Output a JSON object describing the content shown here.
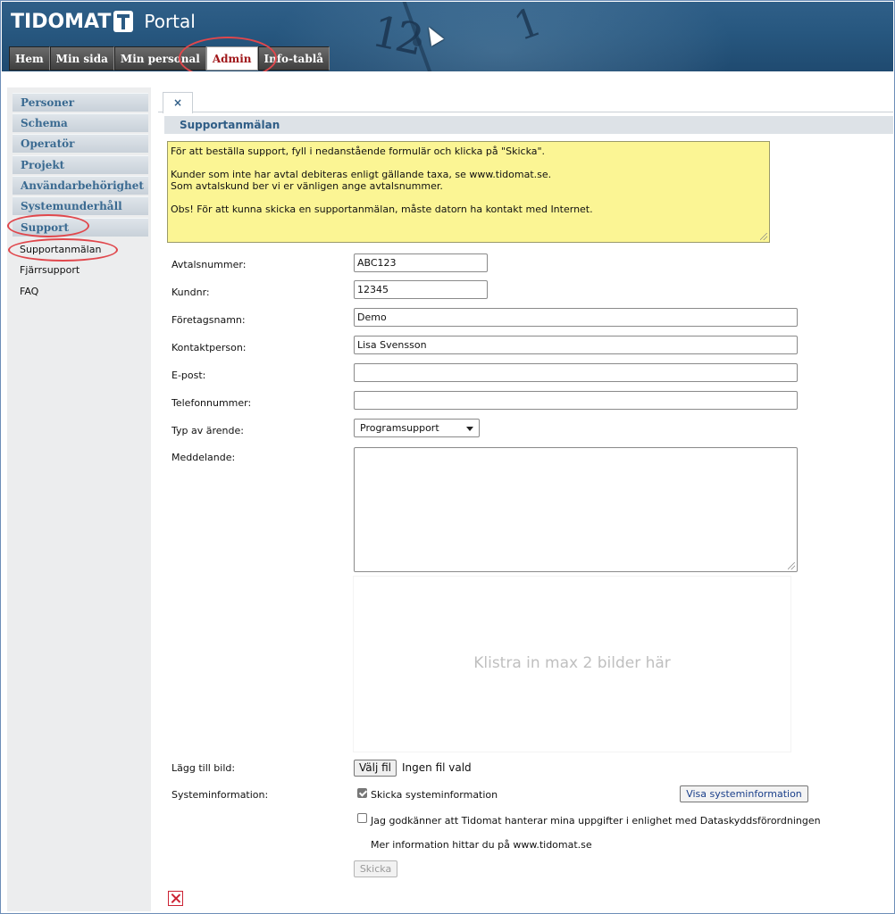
{
  "header": {
    "logo_text": "TIDOMAT",
    "portal_label": "Portal",
    "clock_num_12": "12",
    "clock_num_1": "1"
  },
  "nav_tabs": [
    {
      "label": "Hem"
    },
    {
      "label": "Min sida"
    },
    {
      "label": "Min personal"
    },
    {
      "label": "Admin",
      "active": true
    },
    {
      "label": "Info-tablå"
    }
  ],
  "sidebar": {
    "items": [
      {
        "label": "Personer"
      },
      {
        "label": "Schema"
      },
      {
        "label": "Operatör"
      },
      {
        "label": "Projekt"
      },
      {
        "label": "Användarbehörighet"
      },
      {
        "label": "Systemunderhåll"
      },
      {
        "label": "Support"
      }
    ],
    "sub_items": [
      {
        "label": "Supportanmälan"
      },
      {
        "label": "Fjärrsupport"
      },
      {
        "label": "FAQ"
      }
    ]
  },
  "content": {
    "close_tab_label": "×",
    "section_title": "Supportanmälan",
    "info_lines": [
      "För att beställa support, fyll i nedanstående formulär och klicka på \"Skicka\".",
      "Kunder som inte har avtal debiteras enligt gällande taxa, se www.tidomat.se.",
      "Som avtalskund ber vi er vänligen ange avtalsnummer.",
      "Obs! För att kunna skicka en supportanmälan, måste datorn ha kontakt med Internet."
    ]
  },
  "form": {
    "agreement_label": "Avtalsnummer:",
    "agreement_value": "ABC123",
    "customer_label": "Kundnr:",
    "customer_value": "12345",
    "company_label": "Företagsnamn:",
    "company_value": "Demo",
    "contact_label": "Kontaktperson:",
    "contact_value": "Lisa Svensson",
    "email_label": "E-post:",
    "email_value": "",
    "phone_label": "Telefonnummer:",
    "phone_value": "",
    "type_label": "Typ av ärende:",
    "type_value": "Programsupport",
    "message_label": "Meddelande:",
    "paste_placeholder": "Klistra in max 2 bilder här",
    "add_image_label": "Lägg till bild:",
    "choose_file_label": "Välj fil",
    "no_file_text": "Ingen fil vald",
    "sysinfo_label": "Systeminformation:",
    "send_sysinfo_label": "Skicka systeminformation",
    "send_sysinfo_checked": true,
    "show_sysinfo_button": "Visa systeminformation",
    "gdpr_label": "Jag godkänner att Tidomat hanterar mina uppgifter i enlighet med Dataskyddsförordningen",
    "gdpr_checked": false,
    "more_info_text": "Mer information hittar du på www.tidomat.se",
    "send_button": "Skicka"
  },
  "colors": {
    "header_blue": "#27577f",
    "admin_tab_red": "#a0171a",
    "nav_text_blue": "#3a6a91",
    "info_yellow": "#fbf594",
    "annotation_red": "#e0474c"
  }
}
